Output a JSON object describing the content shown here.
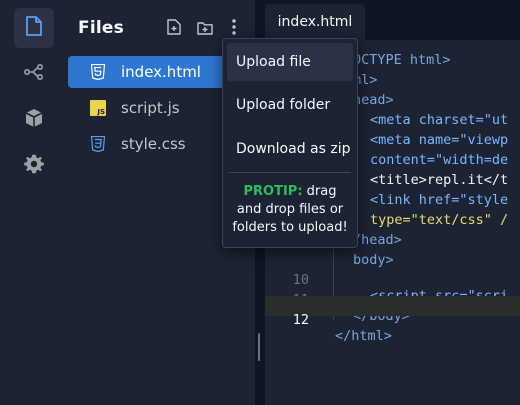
{
  "sidebar": {
    "items": [
      {
        "name": "files-icon"
      },
      {
        "name": "share-icon"
      },
      {
        "name": "packages-icon"
      },
      {
        "name": "settings-icon"
      }
    ]
  },
  "files_panel": {
    "title": "Files",
    "actions": [
      "new-file-icon",
      "new-folder-icon",
      "more-icon"
    ],
    "files": [
      {
        "name": "index.html",
        "icon": "html5-icon",
        "active": true
      },
      {
        "name": "script.js",
        "icon": "js-icon",
        "icon_text": "JS",
        "active": false
      },
      {
        "name": "style.css",
        "icon": "css3-icon",
        "active": false
      }
    ]
  },
  "editor": {
    "tab": "index.html",
    "current_line": "12",
    "lines": [
      {
        "num": "",
        "text": "OCTYPE html>"
      },
      {
        "num": "",
        "text": "ml>"
      },
      {
        "num": "",
        "text": "head>"
      },
      {
        "num": "",
        "text": "<meta charset=\"ut"
      },
      {
        "num": "",
        "text": "<meta name=\"viewp"
      },
      {
        "num": "",
        "text": "content=\"width=de"
      },
      {
        "num": "",
        "text": "<title>repl.it</t"
      },
      {
        "num": "",
        "text": "<link href=\"style"
      },
      {
        "num": "",
        "text": "type=\"text/css\" /"
      },
      {
        "num": "",
        "text": "/head>"
      },
      {
        "num": "",
        "text": "body>"
      },
      {
        "num": "10",
        "text": "<script src=\"scri"
      },
      {
        "num": "11",
        "text": "</body>"
      },
      {
        "num": "12",
        "text": "</html>"
      }
    ]
  },
  "menu": {
    "items": [
      "Upload file",
      "Upload folder",
      "Download as zip"
    ],
    "protip_label": "PROTIP:",
    "protip_text": "drag and drop files or folders to upload!"
  },
  "colors": {
    "accent": "#2f76d1",
    "protip": "#2ebd59",
    "background": "#1c2333"
  }
}
